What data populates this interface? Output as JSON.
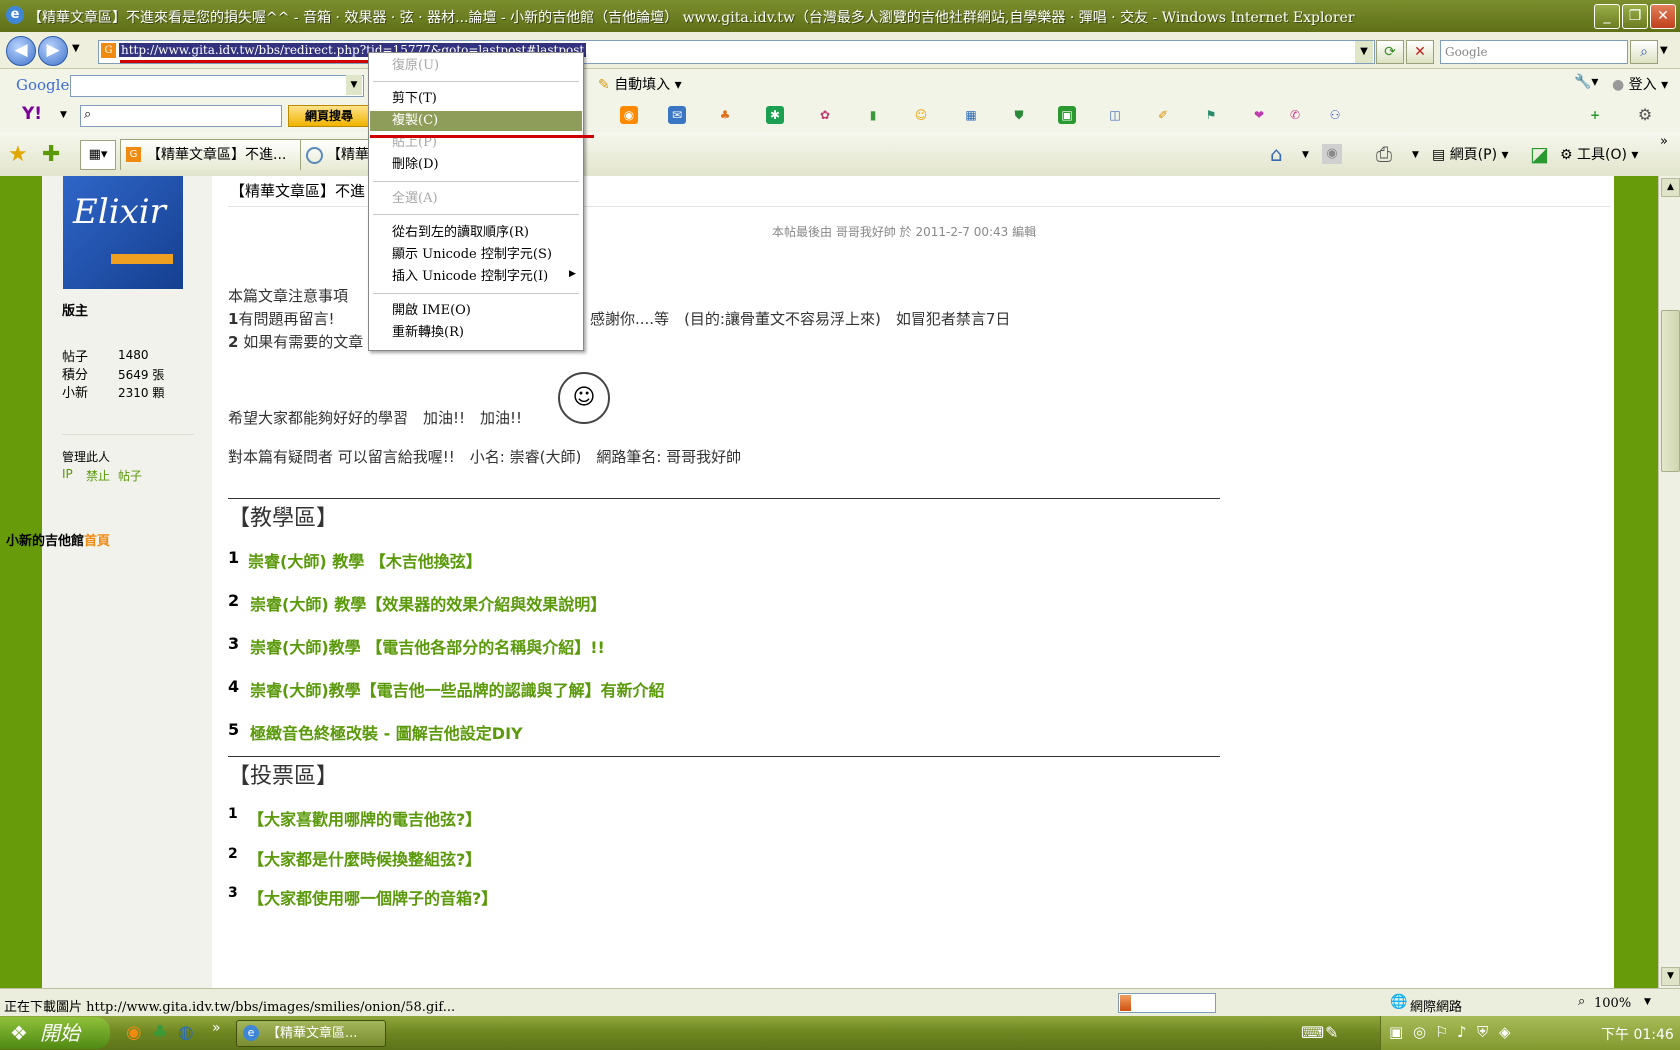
{
  "window": {
    "title": "【精華文章區】不進來看是您的損失喔^^ - 音箱 · 效果器 · 弦 · 器材...論壇 - 小新的吉他館（吉他論壇） www.gita.idv.tw（台灣最多人瀏覽的吉他社群網站,自學樂器 · 彈唱 · 交友 - Windows Internet Explorer",
    "min": "_",
    "max": "❐",
    "close": "✕"
  },
  "address": {
    "url": "http://www.gita.idv.tw/bbs/redirect.php?tid=15777&goto=lastpost#lastpost",
    "search_placeholder": "Google"
  },
  "google_toolbar": {
    "logo": "Google",
    "autofill": "自動填入",
    "signin": "登入"
  },
  "yahoo_toolbar": {
    "logo": "Y!",
    "search_button": "網頁搜尋"
  },
  "tabs": [
    {
      "label": "【精華文章區】不進..."
    },
    {
      "label": "【精華"
    }
  ],
  "command_bar": {
    "page": "網頁(P)",
    "tools": "工具(O)"
  },
  "context_menu": {
    "undo": "復原(U)",
    "cut": "剪下(T)",
    "copy": "複製(C)",
    "paste": "貼上(P)",
    "delete": "刪除(D)",
    "select_all": "全選(A)",
    "rtl": "從右到左的讀取順序(R)",
    "show_unicode": "顯示 Unicode 控制字元(S)",
    "insert_unicode": "插入 Unicode 控制字元(I)",
    "open_ime": "開啟 IME(O)",
    "reconvert": "重新轉換(R)"
  },
  "sidebar": {
    "banner": "Elixir",
    "role": "版主",
    "stats": [
      {
        "label": "帖子",
        "value": "1480"
      },
      {
        "label": "積分",
        "value": "5649 張"
      },
      {
        "label": "小新",
        "value": "2310 顆"
      }
    ],
    "manage": "管理此人",
    "ip": "IP",
    "ban": "禁止",
    "posts": "帖子",
    "site_name": "小新的吉他館",
    "home": "首頁"
  },
  "post": {
    "title": "【精華文章區】不進",
    "edited": "本帖最後由 哥哥我好帥 於 2011-2-7 00:43 編輯",
    "notice": "本篇文章注意事項",
    "rule1_num": "1",
    "rule1_a": "有問題再留言!",
    "rule1_b": "感謝你....等　(目的:讓骨董文不容易浮上來)　如冒犯者禁言7日",
    "rule2_num": "2",
    "rule2": "如果有需要的文章",
    "cheer": "希望大家都能夠好好的學習　加油!!　加油!!",
    "contact": "對本篇有疑問者 可以留言給我喔!!　小名: 崇睿(大師)　網路筆名: 哥哥我好帥",
    "teach_title": "【教學區】",
    "teach": [
      {
        "num": "1",
        "text": "崇睿(大師) 教學 【木吉他換弦】"
      },
      {
        "num": "2",
        "text": "崇睿(大師) 教學【效果器的效果介紹與效果說明】"
      },
      {
        "num": "3",
        "text": "崇睿(大師)教學 【電吉他各部分的名稱與介紹】!!"
      },
      {
        "num": "4",
        "text": "崇睿(大師)教學【電吉他一些品牌的認識與了解】有新介紹"
      },
      {
        "num": "5",
        "text": "極緻音色終極改裝 - 圖解吉他設定DIY"
      }
    ],
    "vote_title": "【投票區】",
    "votes": [
      {
        "num": "1",
        "text": "【大家喜歡用哪牌的電吉他弦?】"
      },
      {
        "num": "2",
        "text": "【大家都是什麼時候換整組弦?】"
      },
      {
        "num": "3",
        "text": "【大家都使用哪一個牌子的音箱?】"
      }
    ]
  },
  "status": {
    "text": "正在下載圖片 http://www.gita.idv.tw/bbs/images/smilies/onion/58.gif...",
    "zone": "網際網路",
    "zoom": "100%",
    "progress": 0.12
  },
  "taskbar": {
    "start": "開始",
    "item": "【精華文章區...",
    "clock": "下午 01:46"
  },
  "colors": {
    "accent_green": "#679b0a",
    "link_green": "#5a9a0a",
    "highlight": "#8f9d5a",
    "underline_red": "#d00000"
  }
}
